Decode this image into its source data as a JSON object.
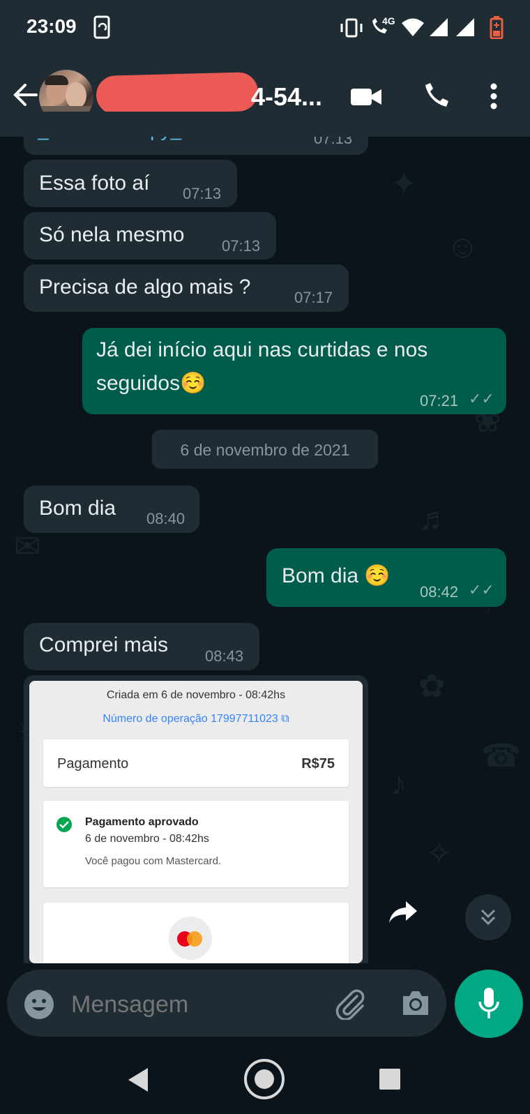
{
  "status_bar": {
    "time": "23:09",
    "network": "4G"
  },
  "header": {
    "contact_name": "4-54..."
  },
  "chat": {
    "partial_top": {
      "text": "_medium=copy_link",
      "time": "07:13"
    },
    "messages": [
      {
        "text": "Essa foto aí",
        "time": "07:13"
      },
      {
        "text": "Só nela mesmo",
        "time": "07:13"
      },
      {
        "text": "Precisa de algo mais ?",
        "time": "07:17"
      },
      {
        "line1": "Já dei início aqui nas curtidas e nos",
        "line2": "seguidos☺️",
        "time": "07:21"
      },
      {
        "text": "Bom dia",
        "time": "08:40"
      },
      {
        "text": "Bom dia ☺️",
        "time": "08:42"
      },
      {
        "text": "Comprei mais",
        "time": "08:43"
      }
    ],
    "date_chip": "6 de novembro de 2021",
    "receipt": {
      "created": "Criada em 6 de novembro - 08:42hs",
      "operation": "Número de operação 17997711023 ⧉",
      "payment_label": "Pagamento",
      "payment_value": "R$75",
      "approved_title": "Pagamento aprovado",
      "approved_date": "6 de novembro - 08:42hs",
      "paid_with": "Você pagou com Mastercard."
    }
  },
  "composer": {
    "placeholder": "Mensagem"
  },
  "colors": {
    "incoming": "#1f2c34",
    "outgoing": "#005c4b",
    "accent": "#00a884",
    "link": "#53bdeb"
  },
  "icons": [
    "back-arrow-icon",
    "video-call-icon",
    "phone-icon",
    "more-vert-icon",
    "emoji-icon",
    "attach-icon",
    "camera-icon",
    "mic-icon",
    "forward-icon",
    "scroll-down-icon",
    "nav-back-icon",
    "nav-home-icon",
    "nav-recents-icon"
  ]
}
